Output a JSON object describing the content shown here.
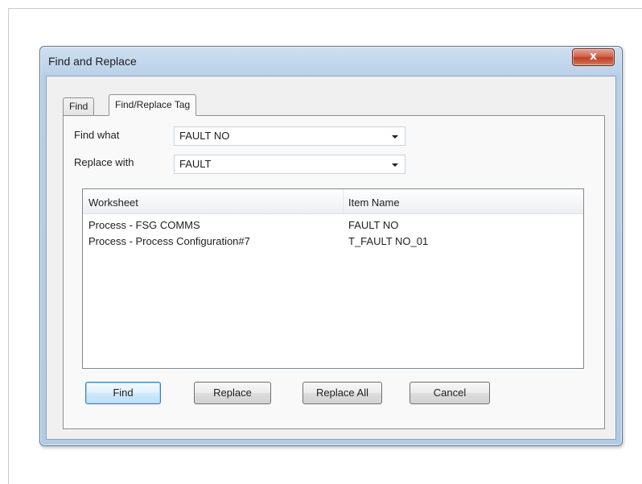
{
  "window": {
    "title": "Find and Replace",
    "close_glyph": "x"
  },
  "tabs": [
    {
      "label": "Find",
      "active": false
    },
    {
      "label": "Find/Replace Tag",
      "active": true
    }
  ],
  "find_what": {
    "label": "Find what",
    "value": "FAULT NO"
  },
  "replace_with": {
    "label": "Replace with",
    "value": "FAULT"
  },
  "results": {
    "columns": [
      "Worksheet",
      "Item Name"
    ],
    "rows": [
      [
        "Process - FSG COMMS",
        "FAULT NO"
      ],
      [
        "Process - Process Configuration#7",
        "T_FAULT NO_01"
      ]
    ]
  },
  "buttons": {
    "find": "Find",
    "replace": "Replace",
    "replace_all": "Replace All",
    "cancel": "Cancel"
  },
  "icons": {
    "combo_arrow": "chevron-down-icon",
    "close": "close-icon"
  },
  "colors": {
    "title_bar": "#bcd3ea",
    "close_button": "#c94a33",
    "default_button_border": "#3c7fb1",
    "dialog_background": "#f0f0f0"
  }
}
